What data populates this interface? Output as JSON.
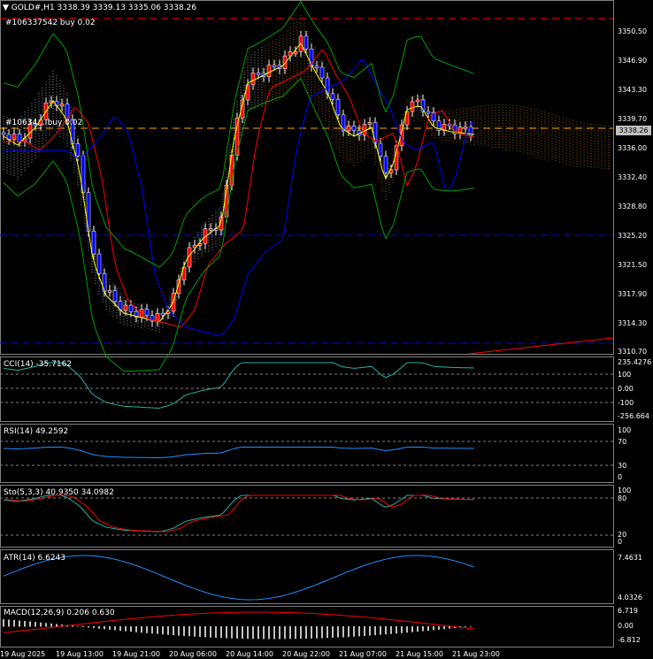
{
  "header": {
    "arrow": "▼",
    "title": "GOLD#,H1  3338.39 3339.13 3335.06 3338.26"
  },
  "orders": {
    "buy_top": "#106337542 buy 0.02",
    "buy_mid": "#10634... buy 0.02"
  },
  "price_axis": {
    "labels": [
      "3350.50",
      "3346.90",
      "3343.30",
      "3339.70",
      "3336.00",
      "3332.40",
      "3328.80",
      "3325.20",
      "3321.50",
      "3317.90",
      "3314.30",
      "3310.70"
    ],
    "current_price": "3338.26"
  },
  "indicators": {
    "cci": {
      "title": "CCI(14) -35.7162",
      "levels": [
        "235.4276",
        "100",
        "0.00",
        "-100",
        "-256.664"
      ]
    },
    "rsi": {
      "title": "RSI(14) 49.2592",
      "levels": [
        "100",
        "70",
        "30",
        "0"
      ]
    },
    "sto": {
      "title": "Sto(5,3,3) 40.9350 34.0982",
      "levels": [
        "100",
        "80",
        "20",
        "0"
      ]
    },
    "atr": {
      "title": "ATR(14) 6.6243",
      "levels": [
        "7.4631",
        "4.0326"
      ]
    },
    "macd": {
      "title": "MACD(12,26,9) 0.206 0.630",
      "levels": [
        "6.719",
        "0.00",
        "-6.812"
      ]
    }
  },
  "time_axis": [
    "19 Aug 2025",
    "19 Aug 13:00",
    "19 Aug 21:00",
    "20 Aug 06:00",
    "20 Aug 14:00",
    "20 Aug 22:00",
    "21 Aug 07:00",
    "21 Aug 15:00",
    "21 Aug 23:00"
  ],
  "colors": {
    "bull": "#ff0000",
    "bear": "#0000ff",
    "ma_fast": "#ffff00",
    "ma_mid": "#ff0000",
    "ma_slow": "#0000ff",
    "bands": "#00a000",
    "cci": "#20b2aa",
    "rsi": "#1e90ff",
    "sto_main": "#20b2aa",
    "sto_signal": "#ff0000",
    "atr": "#1e90ff",
    "macd_hist": "#c0c0c0",
    "macd_signal": "#ff0000",
    "order_line": "#ff0000",
    "bid_line": "#ffa500",
    "level_line": "#0000ff",
    "cloud": "#ffa500"
  }
}
